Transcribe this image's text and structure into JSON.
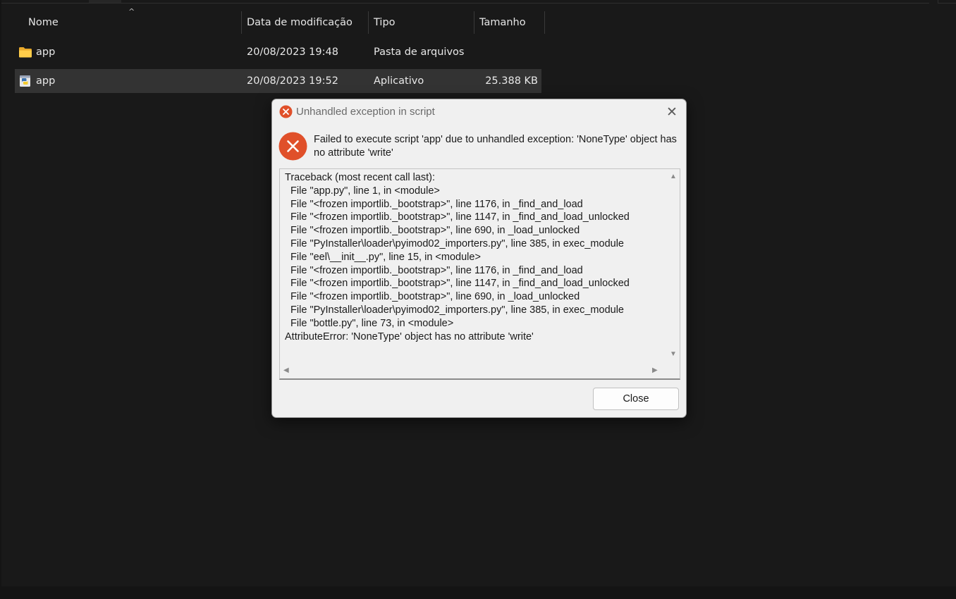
{
  "explorer": {
    "columns": [
      "Nome",
      "Data de modificação",
      "Tipo",
      "Tamanho"
    ],
    "sort_indicator": "^",
    "rows": [
      {
        "icon": "folder-icon",
        "name": "app",
        "modified": "20/08/2023 19:48",
        "type": "Pasta de arquivos",
        "size": ""
      },
      {
        "icon": "python-exe-icon",
        "name": "app",
        "modified": "20/08/2023 19:52",
        "type": "Aplicativo",
        "size": "25.388 KB",
        "selected": true
      }
    ]
  },
  "dialog": {
    "title": "Unhandled exception in script",
    "close_glyph": "✕",
    "message": "Failed to execute script 'app' due to unhandled exception: 'NoneType' object has no attribute 'write'",
    "traceback": "Traceback (most recent call last):\n  File \"app.py\", line 1, in <module>\n  File \"<frozen importlib._bootstrap>\", line 1176, in _find_and_load\n  File \"<frozen importlib._bootstrap>\", line 1147, in _find_and_load_unlocked\n  File \"<frozen importlib._bootstrap>\", line 690, in _load_unlocked\n  File \"PyInstaller\\loader\\pyimod02_importers.py\", line 385, in exec_module\n  File \"eel\\__init__.py\", line 15, in <module>\n  File \"<frozen importlib._bootstrap>\", line 1176, in _find_and_load\n  File \"<frozen importlib._bootstrap>\", line 1147, in _find_and_load_unlocked\n  File \"<frozen importlib._bootstrap>\", line 690, in _load_unlocked\n  File \"PyInstaller\\loader\\pyimod02_importers.py\", line 385, in exec_module\n  File \"bottle.py\", line 73, in <module>\nAttributeError: 'NoneType' object has no attribute 'write'",
    "close_button_label": "Close"
  },
  "colors": {
    "background": "#191919",
    "row_selected": "#333333",
    "error_red": "#e0502a",
    "dialog_bg": "#f0f0f0"
  }
}
